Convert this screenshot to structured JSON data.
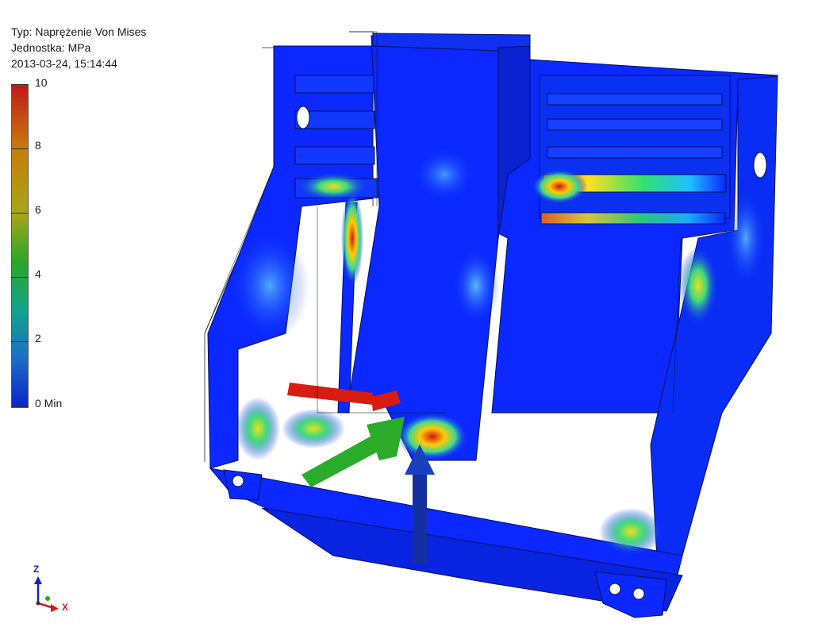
{
  "info": {
    "type_line": "Typ: Naprężenie Von Mises",
    "unit_line": "Jednostka: MPa",
    "timestamp": "2013-03-24, 15:14:44"
  },
  "legend": {
    "labels": [
      "10",
      "8",
      "6",
      "4",
      "2",
      "0 Min"
    ],
    "colors": {
      "max": "#c0181a",
      "high": "#c87d0a",
      "mid_high": "#a6a716",
      "mid": "#2aa52a",
      "mid_low": "#10a48a",
      "low": "#1a6ec8",
      "min": "#0a24c8"
    }
  },
  "triad": {
    "z_label": "Z",
    "x_label": "X",
    "colors": {
      "z": "#1b1bd0",
      "x": "#d01b1b",
      "y": "#1bb01b"
    }
  },
  "model": {
    "base_color": "#0a28ff",
    "load_arrows": {
      "red": "#d81c10",
      "green": "#2aac2a",
      "blue": "#1430a0"
    }
  }
}
